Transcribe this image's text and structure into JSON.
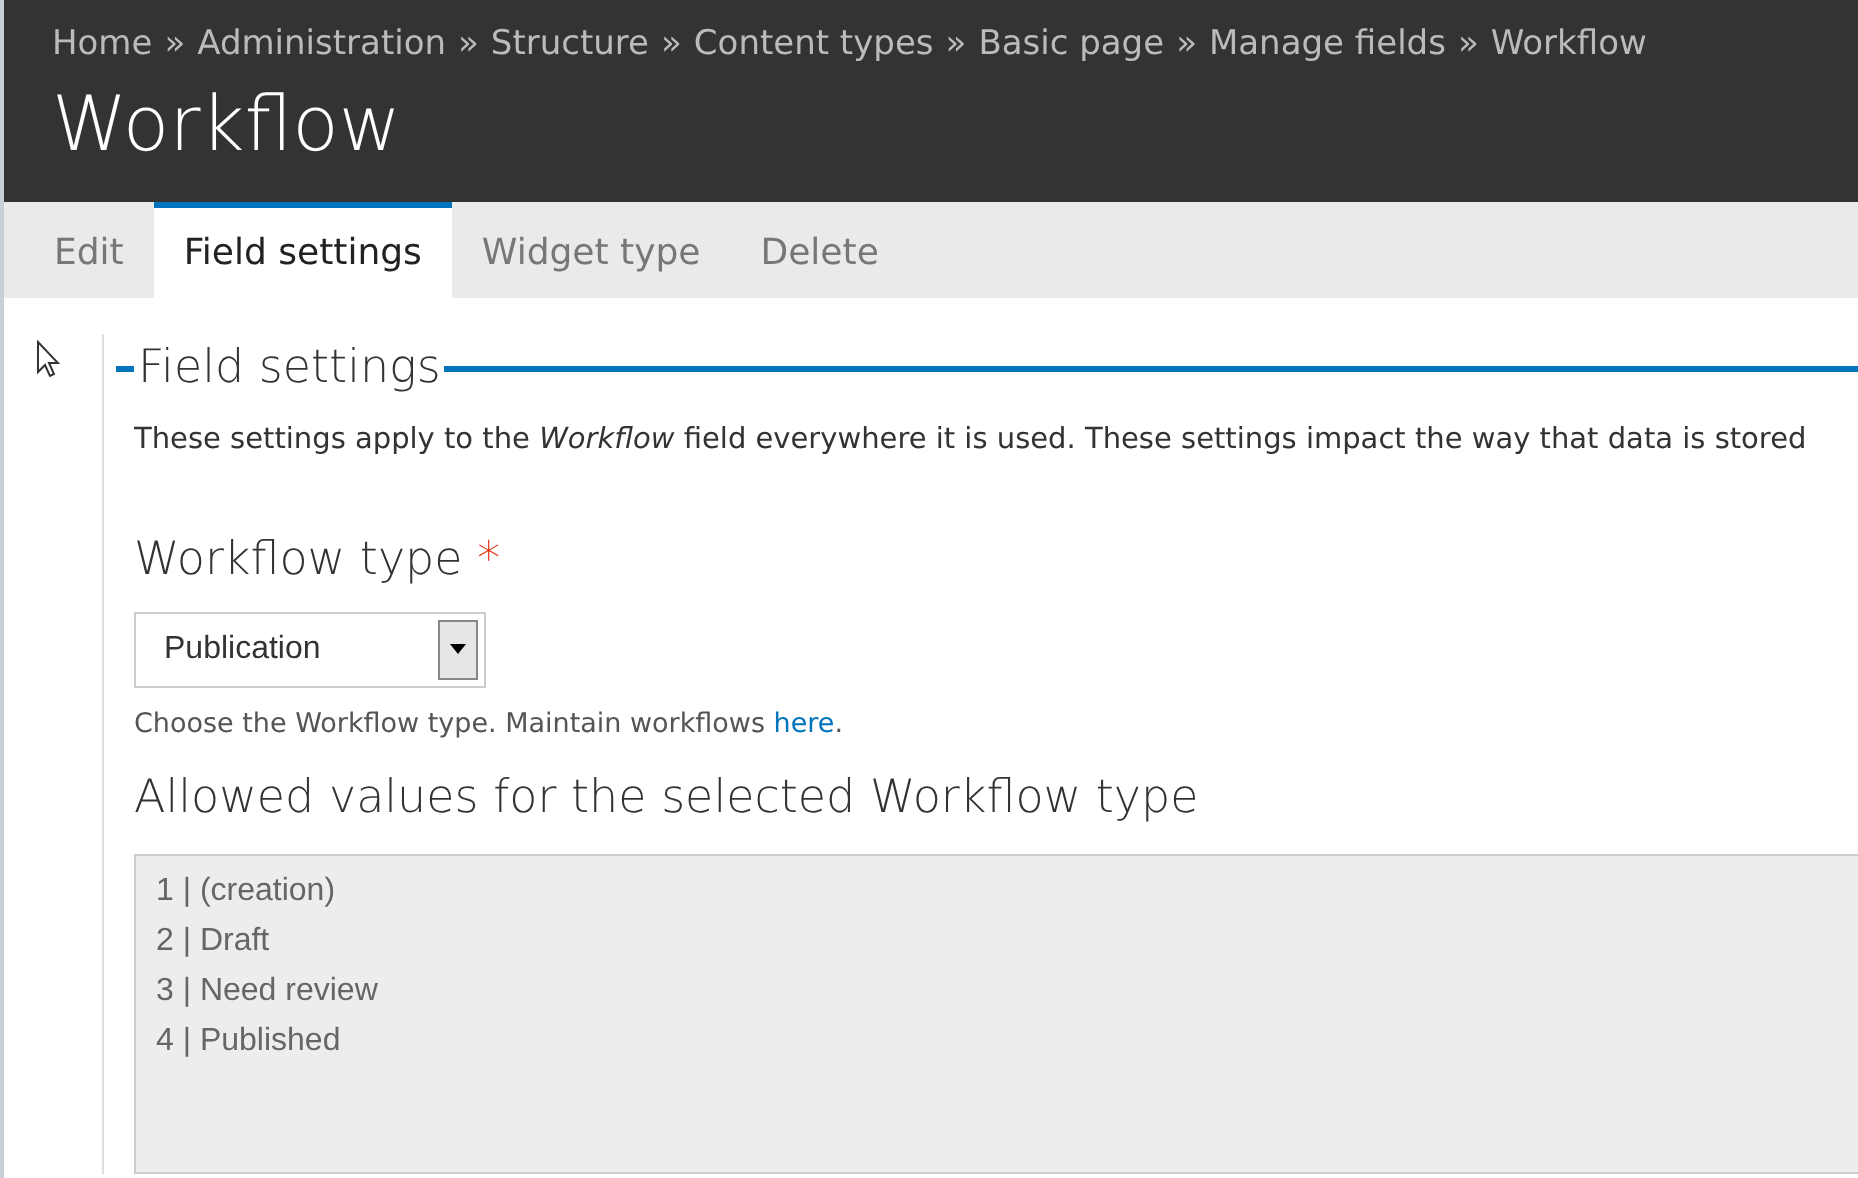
{
  "breadcrumb": {
    "separator": "»",
    "items": [
      "Home",
      "Administration",
      "Structure",
      "Content types",
      "Basic page",
      "Manage fields",
      "Workflow"
    ]
  },
  "page_title": "Workflow",
  "tabs": [
    {
      "label": "Edit",
      "selected": false
    },
    {
      "label": "Field settings",
      "selected": true
    },
    {
      "label": "Widget type",
      "selected": false
    },
    {
      "label": "Delete",
      "selected": false
    }
  ],
  "fieldset": {
    "legend": "Field settings",
    "description": "These settings apply to the *Workflow* field everywhere it is used. These settings impact the way that data is stored",
    "workflow_type": {
      "label": "Workflow type",
      "required": true,
      "required_mark": "*",
      "value": "Publication",
      "help": "Choose the Workflow type. Maintain workflows ",
      "help_link": "here",
      "help_end": "."
    },
    "allowed_values": {
      "label": "Allowed values for the selected Workflow type",
      "lines": [
        "1 | (creation)",
        "2 | Draft",
        "3 | Need review",
        "4 | Published"
      ]
    }
  }
}
